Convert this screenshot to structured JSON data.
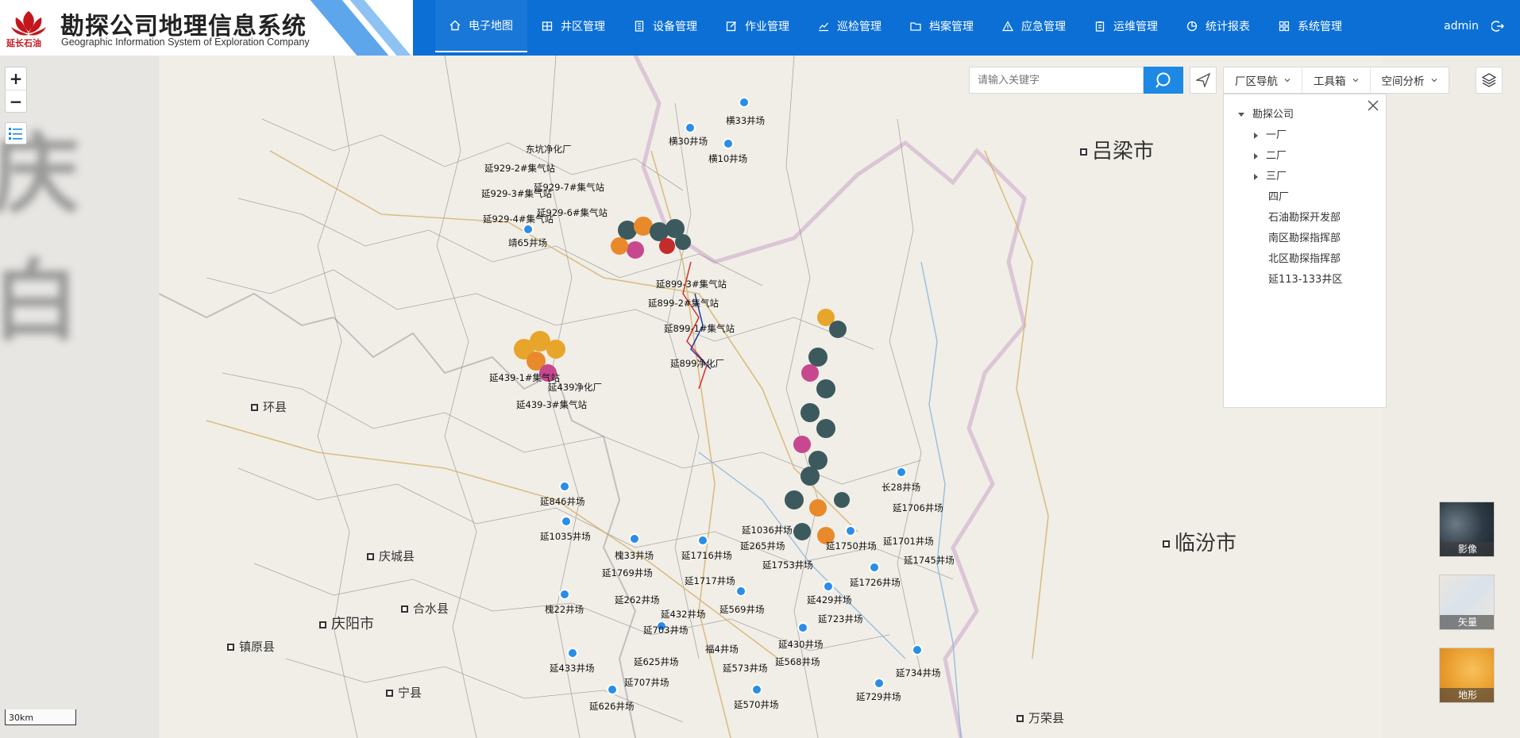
{
  "header": {
    "logo_text": "延长石油",
    "title": "勘探公司地理信息系统",
    "subtitle": "Geographic Information System of Exploration Company",
    "nav": [
      {
        "label": "电子地图",
        "icon": "home-icon",
        "active": true
      },
      {
        "label": "井区管理",
        "icon": "grid-icon",
        "active": false
      },
      {
        "label": "设备管理",
        "icon": "device-icon",
        "active": false
      },
      {
        "label": "作业管理",
        "icon": "edit-icon",
        "active": false
      },
      {
        "label": "巡检管理",
        "icon": "chart-line-icon",
        "active": false
      },
      {
        "label": "档案管理",
        "icon": "folder-icon",
        "active": false
      },
      {
        "label": "应急管理",
        "icon": "warning-icon",
        "active": false
      },
      {
        "label": "运维管理",
        "icon": "clipboard-icon",
        "active": false
      },
      {
        "label": "统计报表",
        "icon": "pie-icon",
        "active": false
      },
      {
        "label": "系统管理",
        "icon": "apps-icon",
        "active": false
      }
    ],
    "user": "admin"
  },
  "toolbar": {
    "search_placeholder": "请输入关键字",
    "dropdowns": [
      "厂区导航",
      "工具箱",
      "空间分析"
    ]
  },
  "tree": {
    "root": "勘探公司",
    "children": [
      {
        "label": "一厂",
        "expandable": true
      },
      {
        "label": "二厂",
        "expandable": true
      },
      {
        "label": "三厂",
        "expandable": true
      },
      {
        "label": "四厂",
        "expandable": false
      },
      {
        "label": "石油勘探开发部",
        "expandable": false
      },
      {
        "label": "南区勘探指挥部",
        "expandable": false
      },
      {
        "label": "北区勘探指挥部",
        "expandable": false
      },
      {
        "label": "延113-133井区",
        "expandable": false
      }
    ]
  },
  "map": {
    "scale_label": "30km",
    "cities": [
      "吕梁市",
      "临汾市",
      "庆阳市",
      "环县",
      "庆城县",
      "合水县",
      "镇原县",
      "宁县",
      "万荣县"
    ],
    "sites": [
      "横33井场",
      "横30井场",
      "横10井场",
      "东坑净化厂",
      "延929-2#集气站",
      "延929-3#集气站",
      "延929-4#集气站",
      "延929-6#集气站",
      "延929-7#集气站",
      "靖65井场",
      "延899-3#集气站",
      "延899-2#集气站",
      "延899-1#集气站",
      "延899净化厂",
      "延439-1#集气站",
      "延439-3#集气站",
      "延439净化厂",
      "延846井场",
      "延1035井场",
      "延1036井场",
      "延1716井场",
      "延265井场",
      "延1753井场",
      "延1750井场",
      "延1701井场",
      "延1745井场",
      "延1706井场",
      "长28井场",
      "槐33井场",
      "延1769井场",
      "延1717井场",
      "延262井场",
      "延1726井场",
      "延429井场",
      "槐22井场",
      "延569井场",
      "延432井场",
      "延723井场",
      "延703井场",
      "福4井场",
      "延430井场",
      "延625井场",
      "延568井场",
      "延433井场",
      "延573井场",
      "延734井场",
      "延707井场",
      "延729井场",
      "延626井场",
      "延570井场"
    ]
  },
  "basemaps": [
    "影像",
    "矢量",
    "地形"
  ],
  "colors": {
    "header_bg": "#0b6fd6",
    "accent": "#1e88e5",
    "well_icon": "#2a8de8",
    "brand_red": "#c4161c"
  }
}
